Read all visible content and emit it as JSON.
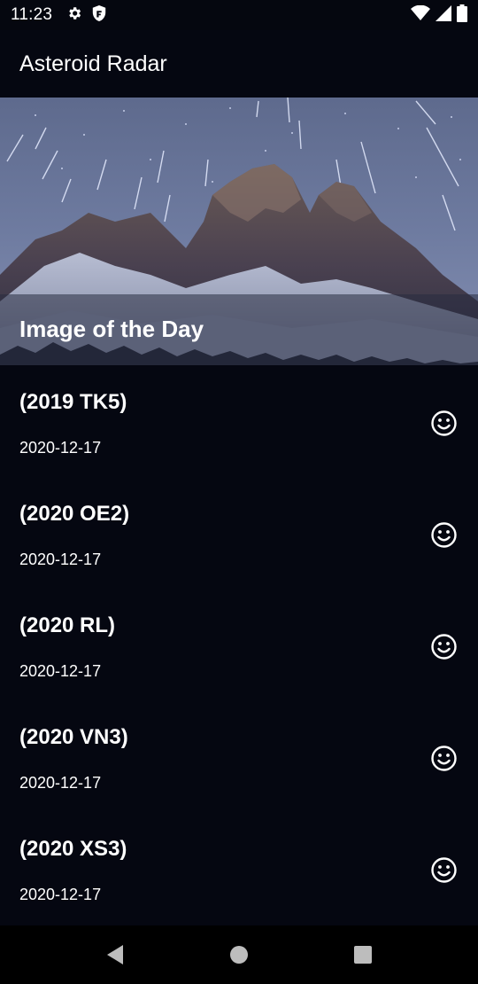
{
  "status_bar": {
    "time": "11:23",
    "left_icons": [
      "gear-icon",
      "shield-icon"
    ],
    "right_icons": [
      "wifi-icon",
      "cell-signal-icon",
      "battery-icon"
    ]
  },
  "app_bar": {
    "title": "Asteroid Radar"
  },
  "hero": {
    "caption": "Image of the Day"
  },
  "asteroids": [
    {
      "name": "(2019 TK5)",
      "date": "2020-12-17",
      "icon": "smiley-face-icon"
    },
    {
      "name": "(2020 OE2)",
      "date": "2020-12-17",
      "icon": "smiley-face-icon"
    },
    {
      "name": "(2020 RL)",
      "date": "2020-12-17",
      "icon": "smiley-face-icon"
    },
    {
      "name": "(2020 VN3)",
      "date": "2020-12-17",
      "icon": "smiley-face-icon"
    },
    {
      "name": "(2020 XS3)",
      "date": "2020-12-17",
      "icon": "smiley-face-icon"
    }
  ],
  "nav_bar": {
    "buttons": [
      "back-icon",
      "home-icon",
      "recents-icon"
    ]
  },
  "colors": {
    "background": "#050711",
    "text": "#ffffff"
  }
}
